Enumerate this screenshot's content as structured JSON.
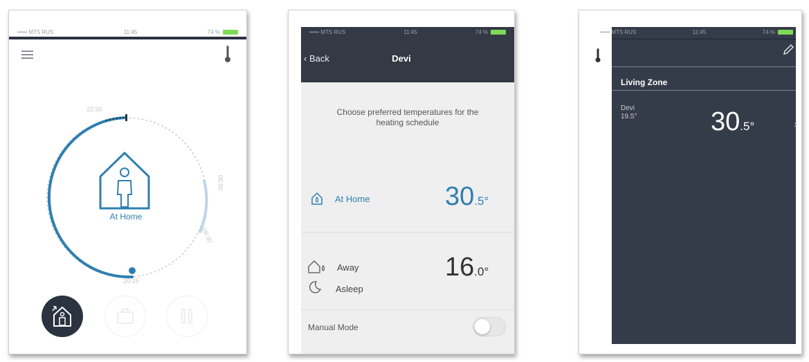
{
  "screen1": {
    "status": {
      "carrier": "••••• MTS RUS",
      "time": "11:45",
      "battery": "74 %"
    },
    "dial": {
      "time_top": "22:30",
      "time_right1": "06:00",
      "time_right2": "08:30",
      "time_bottom": "20:15"
    },
    "mode_label": "At Home"
  },
  "screen2": {
    "status": {
      "carrier": "••••• MTS RUS",
      "time": "11:45",
      "battery": "74 %"
    },
    "back_label": "Back",
    "title": "Devi",
    "instruction": "Choose preferred temperatures for the heating schedule",
    "at_home": {
      "label": "At Home",
      "value": "30",
      "decimal": ".5°"
    },
    "away": {
      "label": "Away"
    },
    "asleep": {
      "label": "Asleep"
    },
    "away_asleep_value": "16",
    "away_asleep_decimal": ".0°",
    "manual_mode_label": "Manual Mode",
    "colors": {
      "accent": "#2e7fb0",
      "navbar": "#333a46"
    }
  },
  "screen3": {
    "status": {
      "carrier": "••••• MTS RUS",
      "time": "11:45",
      "battery": "74 %"
    },
    "zone_title": "Living Zone",
    "device_name": "Devi",
    "device_current": "19.5°",
    "set_value": "30",
    "set_decimal": ".5°",
    "colors": {
      "panel": "#353c49"
    }
  }
}
